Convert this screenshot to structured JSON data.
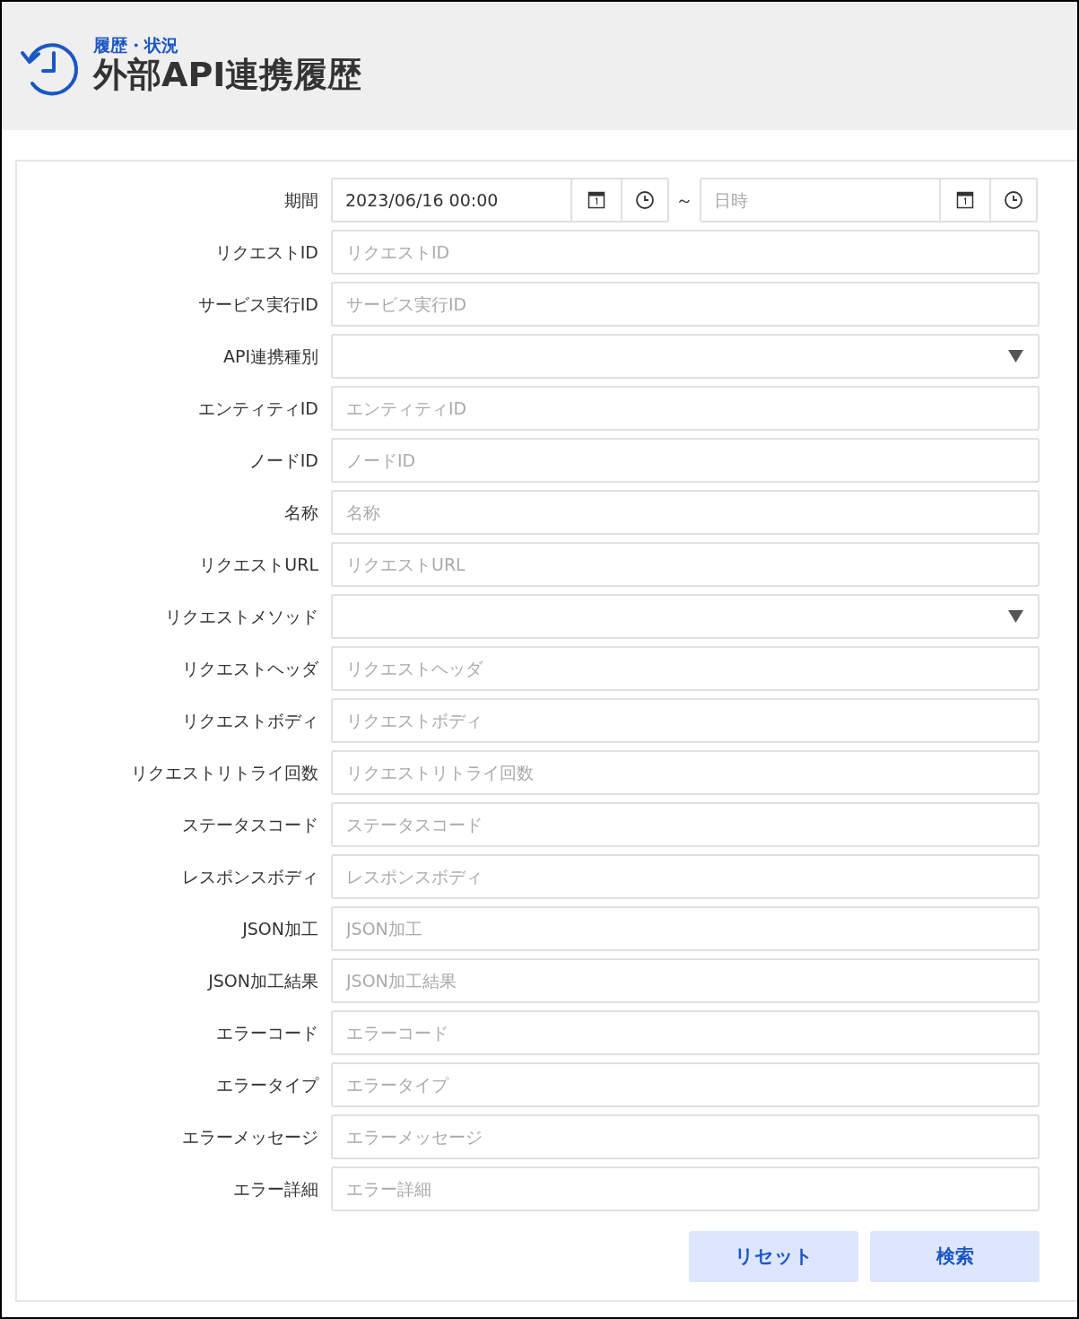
{
  "header": {
    "breadcrumb": "履歴・状況",
    "title": "外部API連携履歴"
  },
  "fields": [
    {
      "kind": "date_range",
      "label": "期間",
      "from_value": "2023/06/16 00:00",
      "to_placeholder": "日時"
    },
    {
      "kind": "text",
      "label": "リクエストID",
      "placeholder": "リクエストID"
    },
    {
      "kind": "text",
      "label": "サービス実行ID",
      "placeholder": "サービス実行ID"
    },
    {
      "kind": "select",
      "label": "API連携種別"
    },
    {
      "kind": "text",
      "label": "エンティティID",
      "placeholder": "エンティティID"
    },
    {
      "kind": "text",
      "label": "ノードID",
      "placeholder": "ノードID"
    },
    {
      "kind": "text",
      "label": "名称",
      "placeholder": "名称"
    },
    {
      "kind": "text",
      "label": "リクエストURL",
      "placeholder": "リクエストURL"
    },
    {
      "kind": "select",
      "label": "リクエストメソッド"
    },
    {
      "kind": "text",
      "label": "リクエストヘッダ",
      "placeholder": "リクエストヘッダ"
    },
    {
      "kind": "text",
      "label": "リクエストボディ",
      "placeholder": "リクエストボディ"
    },
    {
      "kind": "text",
      "label": "リクエストリトライ回数",
      "placeholder": "リクエストリトライ回数"
    },
    {
      "kind": "text",
      "label": "ステータスコード",
      "placeholder": "ステータスコード"
    },
    {
      "kind": "text",
      "label": "レスポンスボディ",
      "placeholder": "レスポンスボディ"
    },
    {
      "kind": "text",
      "label": "JSON加工",
      "placeholder": "JSON加工"
    },
    {
      "kind": "text",
      "label": "JSON加工結果",
      "placeholder": "JSON加工結果"
    },
    {
      "kind": "text",
      "label": "エラーコード",
      "placeholder": "エラーコード"
    },
    {
      "kind": "text",
      "label": "エラータイプ",
      "placeholder": "エラータイプ"
    },
    {
      "kind": "text",
      "label": "エラーメッセージ",
      "placeholder": "エラーメッセージ"
    },
    {
      "kind": "text",
      "label": "エラー詳細",
      "placeholder": "エラー詳細"
    }
  ],
  "range_separator": "～",
  "buttons": [
    "リセット",
    "検索"
  ]
}
